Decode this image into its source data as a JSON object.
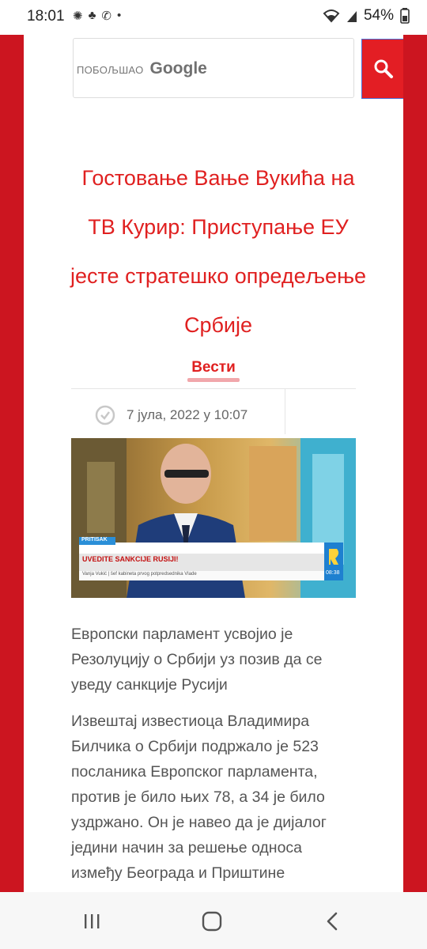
{
  "status": {
    "time": "18:01",
    "battery": "54%"
  },
  "search": {
    "enhanced_label": "ПОБОЉШАО",
    "brand": "Google"
  },
  "article": {
    "title": "Гостовање Вање Вукића на ТВ Курир: Приступање ЕУ јесте стратешко опредељење Србије",
    "category": "Вести",
    "date": "7 јула, 2022 у 10:07",
    "image_overlay": {
      "tag": "PRITISAK",
      "headline": "UVEDITE SANKCIJE RUSIJI!",
      "caption": "Vanja Vukić | šef kabineta prvog potpredsednika Vlade",
      "channel_time": "08:38"
    },
    "lead": "Европски парламент усвојио је Резолуцију о Србији уз позив да се уведу санкције Русији",
    "paragraph": "Извештај известиоца Владимира Билчика о Србији подржало је 523 посланика Европског парламента, против је било њих 78, а 34 је било уздржано. Он је навео да је дијалог једини начин за решење односа између Београда и Приштине"
  },
  "colors": {
    "brand_red": "#cc1520",
    "title_red": "#e02020"
  },
  "icons": [
    "search-icon",
    "clock-icon",
    "recents-icon",
    "home-icon",
    "back-icon",
    "wifi-icon",
    "battery-icon",
    "signal-icon"
  ]
}
